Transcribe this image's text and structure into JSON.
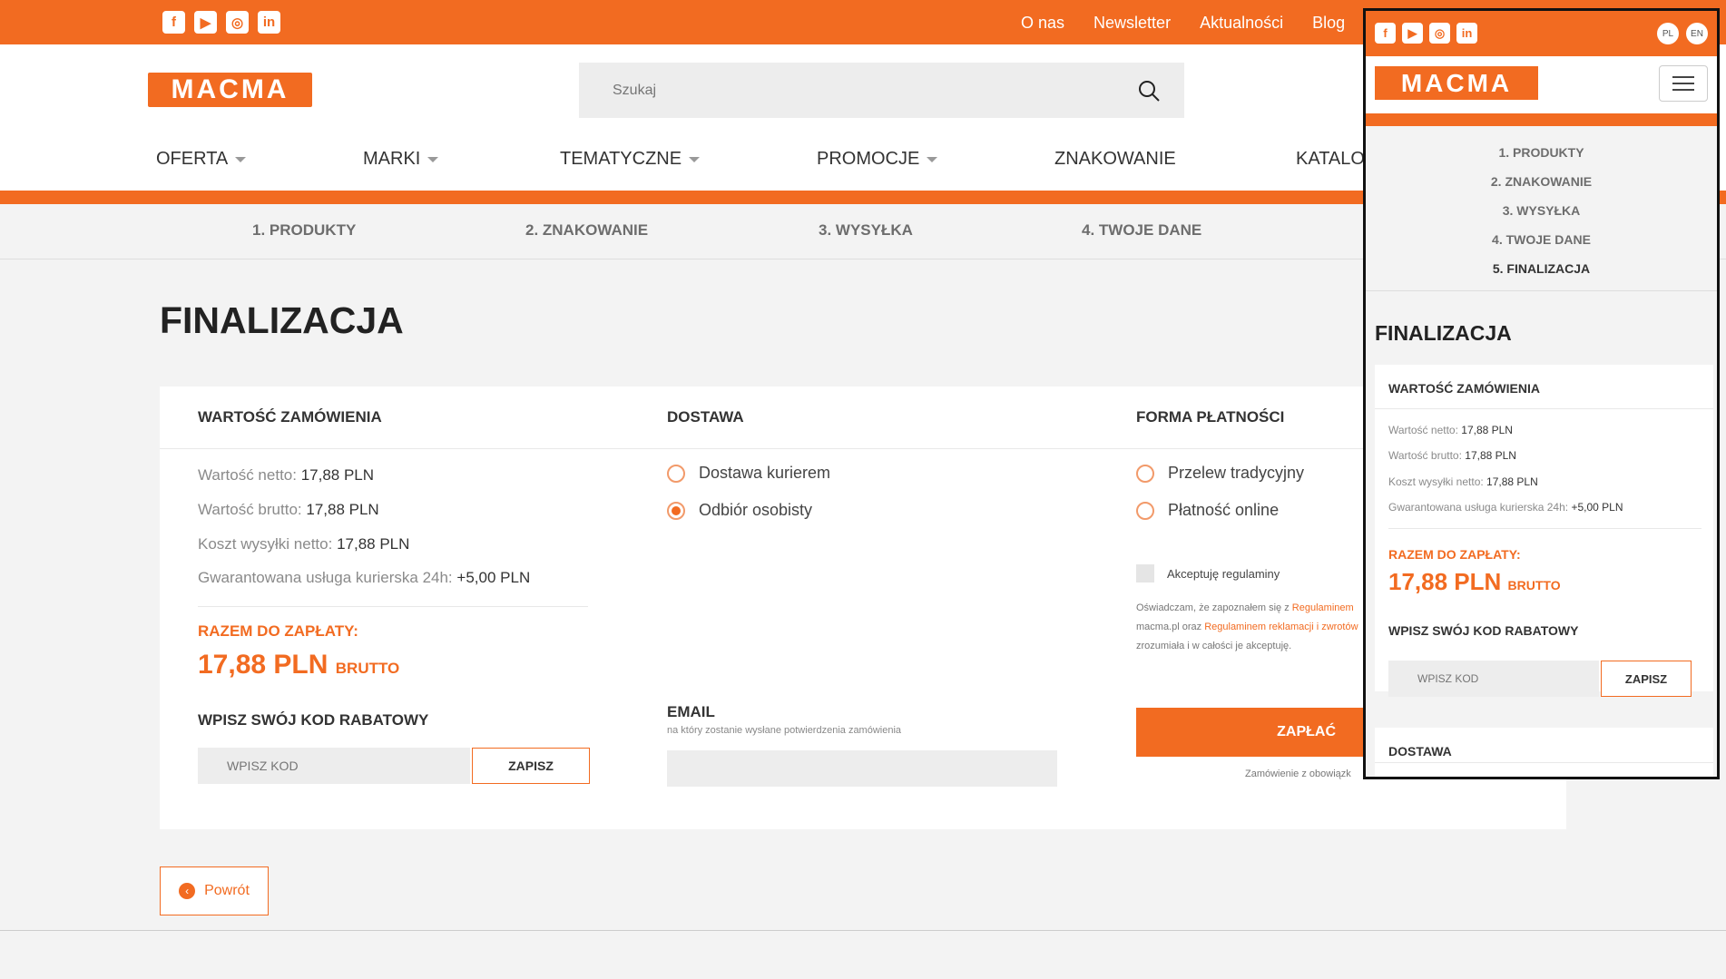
{
  "topbar": {
    "social_icons": [
      "facebook-icon",
      "youtube-icon",
      "instagram-icon",
      "linkedin-icon"
    ],
    "links": [
      "O nas",
      "Newsletter",
      "Aktualności",
      "Blog"
    ]
  },
  "brand": {
    "logo_text": "MACMA",
    "accent_color": "#f26b21"
  },
  "search": {
    "placeholder": "Szukaj"
  },
  "nav": {
    "items": [
      "OFERTA",
      "MARKI",
      "TEMATYCZNE",
      "PROMOCJE",
      "ZNAKOWANIE",
      "KATALO"
    ]
  },
  "steps": [
    "1. PRODUKTY",
    "2. ZNAKOWANIE",
    "3. WYSYŁKA",
    "4. TWOJE DANE"
  ],
  "page": {
    "title": "FINALIZACJA"
  },
  "summary": {
    "heading": "WARTOŚĆ ZAMÓWIENIA",
    "rows": [
      {
        "label": "Wartość netto:",
        "value": "17,88 PLN"
      },
      {
        "label": "Wartość brutto:",
        "value": "17,88 PLN"
      },
      {
        "label": "Koszt wysyłki netto:",
        "value": "17,88 PLN"
      },
      {
        "label": "Gwarantowana usługa kurierska 24h:",
        "value": "+5,00 PLN"
      }
    ],
    "total_label": "RAZEM DO ZAPŁATY:",
    "total_amount": "17,88 PLN",
    "total_suffix": "BRUTTO",
    "discount_heading": "WPISZ SWÓJ KOD RABATOWY",
    "discount_placeholder": "WPISZ KOD",
    "discount_button": "ZAPISZ"
  },
  "delivery": {
    "heading": "DOSTAWA",
    "options": [
      "Dostawa kurierem",
      "Odbiór osobisty"
    ],
    "selected": "Odbiór osobisty",
    "email_heading": "EMAIL",
    "email_subtext": "na który zostanie wysłane potwierdzenia zamówienia"
  },
  "payment": {
    "heading": "FORMA PŁATNOŚCI",
    "options": [
      "Przelew tradycyjny",
      "Płatność online"
    ],
    "terms_label": "Akceptuję regulaminy",
    "terms_text_1": "Oświadczam, że zapoznałem się z ",
    "terms_link_1": "Regulaminem",
    "terms_text_2": "macma.pl oraz ",
    "terms_link_2": "Regulaminem reklamacji i zwrotów",
    "terms_text_3": "zrozumiała i w całości je akceptuję.",
    "pay_button": "ZAPŁAĆ",
    "note": "Zamówienie z obowiązk"
  },
  "back_button": "Powrót",
  "mobile": {
    "langs": [
      "PL",
      "EN"
    ],
    "steps": [
      "1. PRODUKTY",
      "2. ZNAKOWANIE",
      "3. WYSYŁKA",
      "4. TWOJE DANE",
      "5. FINALIZACJA"
    ],
    "delivery_heading": "DOSTAWA"
  }
}
